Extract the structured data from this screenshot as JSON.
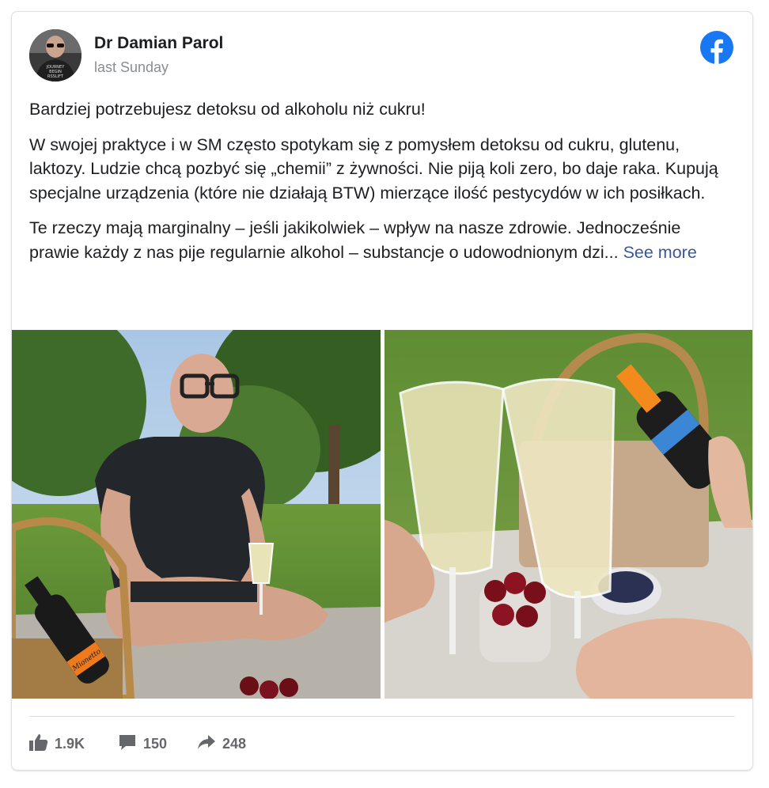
{
  "post": {
    "author": "Dr Damian Parol",
    "time": "last Sunday",
    "platform_icon": "facebook-logo-icon",
    "avatar_shirt_text": [
      "JOURNEY",
      "BEGIN",
      "RSSLIFT"
    ],
    "paragraphs": [
      "Bardziej potrzebujesz detoksu od alkoholu niż cukru!",
      "W swojej praktyce i w SM często spotykam się z pomysłem detoksu od cukru, glutenu, laktozy. Ludzie chcą pozbyć się „chemii” z żywności. Nie piją koli zero, bo daje raka. Kupują specjalne urządzenia (które nie działają BTW) mierzące ilość pestycydów w ich posiłkach.",
      "Te rzeczy mają marginalny – jeśli jakikolwiek – wpływ na nasze zdrowie. Jednocześnie prawie każdy z nas pije regularnie alkohol – substancje o udowodnionym dzi..."
    ],
    "see_more": "See more",
    "bottle_label": "Mionetto",
    "photos": [
      {
        "icon": "photo-man-picnic-icon"
      },
      {
        "icon": "photo-champagne-toast-icon"
      }
    ]
  },
  "stats": {
    "likes": "1.9K",
    "comments": "150",
    "shares": "248"
  },
  "colors": {
    "facebook_blue": "#1877f2",
    "link": "#385898",
    "muted": "#8a8d91",
    "stat": "#65676b"
  }
}
